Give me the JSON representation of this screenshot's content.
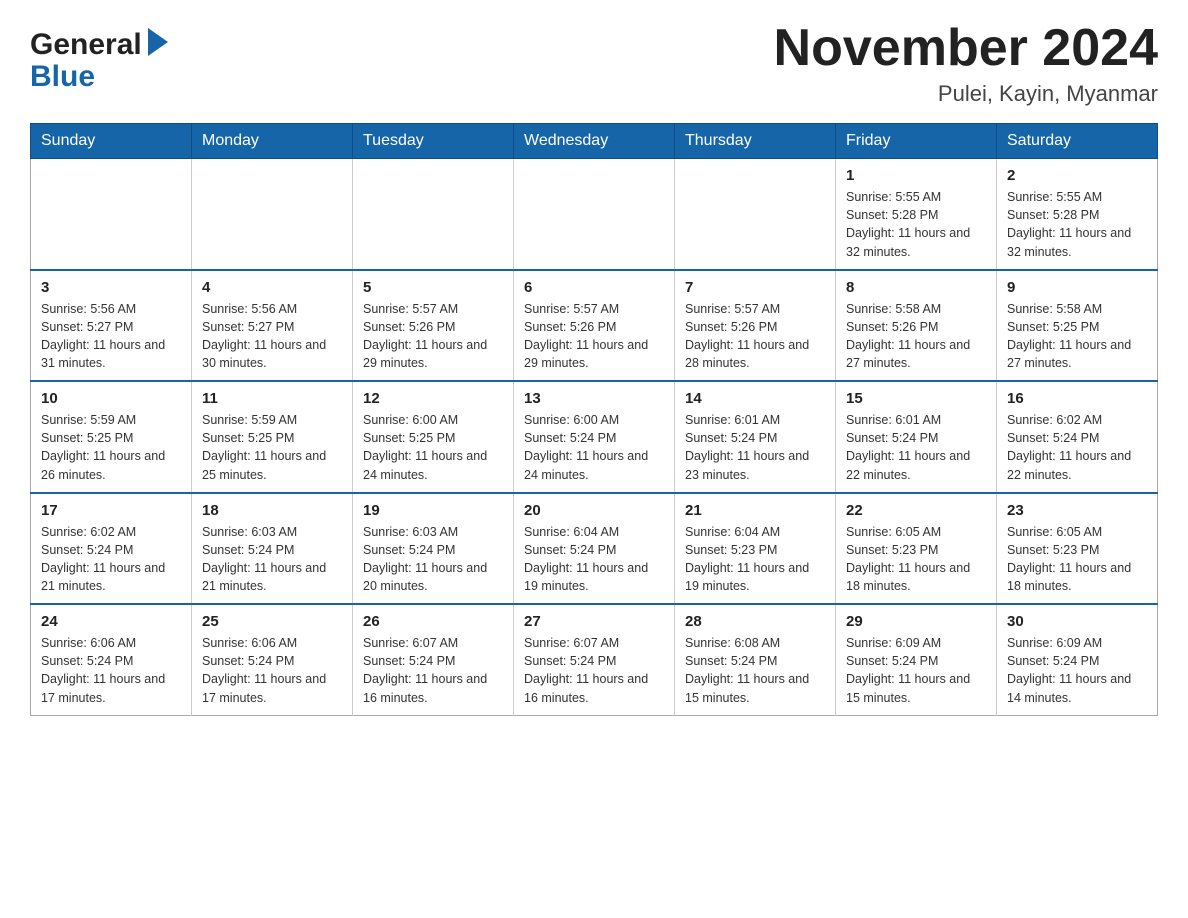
{
  "header": {
    "logo_general": "General",
    "logo_blue": "Blue",
    "month_title": "November 2024",
    "subtitle": "Pulei, Kayin, Myanmar"
  },
  "weekdays": [
    "Sunday",
    "Monday",
    "Tuesday",
    "Wednesday",
    "Thursday",
    "Friday",
    "Saturday"
  ],
  "rows": [
    [
      {
        "day": "",
        "info": ""
      },
      {
        "day": "",
        "info": ""
      },
      {
        "day": "",
        "info": ""
      },
      {
        "day": "",
        "info": ""
      },
      {
        "day": "",
        "info": ""
      },
      {
        "day": "1",
        "info": "Sunrise: 5:55 AM\nSunset: 5:28 PM\nDaylight: 11 hours and 32 minutes."
      },
      {
        "day": "2",
        "info": "Sunrise: 5:55 AM\nSunset: 5:28 PM\nDaylight: 11 hours and 32 minutes."
      }
    ],
    [
      {
        "day": "3",
        "info": "Sunrise: 5:56 AM\nSunset: 5:27 PM\nDaylight: 11 hours and 31 minutes."
      },
      {
        "day": "4",
        "info": "Sunrise: 5:56 AM\nSunset: 5:27 PM\nDaylight: 11 hours and 30 minutes."
      },
      {
        "day": "5",
        "info": "Sunrise: 5:57 AM\nSunset: 5:26 PM\nDaylight: 11 hours and 29 minutes."
      },
      {
        "day": "6",
        "info": "Sunrise: 5:57 AM\nSunset: 5:26 PM\nDaylight: 11 hours and 29 minutes."
      },
      {
        "day": "7",
        "info": "Sunrise: 5:57 AM\nSunset: 5:26 PM\nDaylight: 11 hours and 28 minutes."
      },
      {
        "day": "8",
        "info": "Sunrise: 5:58 AM\nSunset: 5:26 PM\nDaylight: 11 hours and 27 minutes."
      },
      {
        "day": "9",
        "info": "Sunrise: 5:58 AM\nSunset: 5:25 PM\nDaylight: 11 hours and 27 minutes."
      }
    ],
    [
      {
        "day": "10",
        "info": "Sunrise: 5:59 AM\nSunset: 5:25 PM\nDaylight: 11 hours and 26 minutes."
      },
      {
        "day": "11",
        "info": "Sunrise: 5:59 AM\nSunset: 5:25 PM\nDaylight: 11 hours and 25 minutes."
      },
      {
        "day": "12",
        "info": "Sunrise: 6:00 AM\nSunset: 5:25 PM\nDaylight: 11 hours and 24 minutes."
      },
      {
        "day": "13",
        "info": "Sunrise: 6:00 AM\nSunset: 5:24 PM\nDaylight: 11 hours and 24 minutes."
      },
      {
        "day": "14",
        "info": "Sunrise: 6:01 AM\nSunset: 5:24 PM\nDaylight: 11 hours and 23 minutes."
      },
      {
        "day": "15",
        "info": "Sunrise: 6:01 AM\nSunset: 5:24 PM\nDaylight: 11 hours and 22 minutes."
      },
      {
        "day": "16",
        "info": "Sunrise: 6:02 AM\nSunset: 5:24 PM\nDaylight: 11 hours and 22 minutes."
      }
    ],
    [
      {
        "day": "17",
        "info": "Sunrise: 6:02 AM\nSunset: 5:24 PM\nDaylight: 11 hours and 21 minutes."
      },
      {
        "day": "18",
        "info": "Sunrise: 6:03 AM\nSunset: 5:24 PM\nDaylight: 11 hours and 21 minutes."
      },
      {
        "day": "19",
        "info": "Sunrise: 6:03 AM\nSunset: 5:24 PM\nDaylight: 11 hours and 20 minutes."
      },
      {
        "day": "20",
        "info": "Sunrise: 6:04 AM\nSunset: 5:24 PM\nDaylight: 11 hours and 19 minutes."
      },
      {
        "day": "21",
        "info": "Sunrise: 6:04 AM\nSunset: 5:23 PM\nDaylight: 11 hours and 19 minutes."
      },
      {
        "day": "22",
        "info": "Sunrise: 6:05 AM\nSunset: 5:23 PM\nDaylight: 11 hours and 18 minutes."
      },
      {
        "day": "23",
        "info": "Sunrise: 6:05 AM\nSunset: 5:23 PM\nDaylight: 11 hours and 18 minutes."
      }
    ],
    [
      {
        "day": "24",
        "info": "Sunrise: 6:06 AM\nSunset: 5:24 PM\nDaylight: 11 hours and 17 minutes."
      },
      {
        "day": "25",
        "info": "Sunrise: 6:06 AM\nSunset: 5:24 PM\nDaylight: 11 hours and 17 minutes."
      },
      {
        "day": "26",
        "info": "Sunrise: 6:07 AM\nSunset: 5:24 PM\nDaylight: 11 hours and 16 minutes."
      },
      {
        "day": "27",
        "info": "Sunrise: 6:07 AM\nSunset: 5:24 PM\nDaylight: 11 hours and 16 minutes."
      },
      {
        "day": "28",
        "info": "Sunrise: 6:08 AM\nSunset: 5:24 PM\nDaylight: 11 hours and 15 minutes."
      },
      {
        "day": "29",
        "info": "Sunrise: 6:09 AM\nSunset: 5:24 PM\nDaylight: 11 hours and 15 minutes."
      },
      {
        "day": "30",
        "info": "Sunrise: 6:09 AM\nSunset: 5:24 PM\nDaylight: 11 hours and 14 minutes."
      }
    ]
  ]
}
